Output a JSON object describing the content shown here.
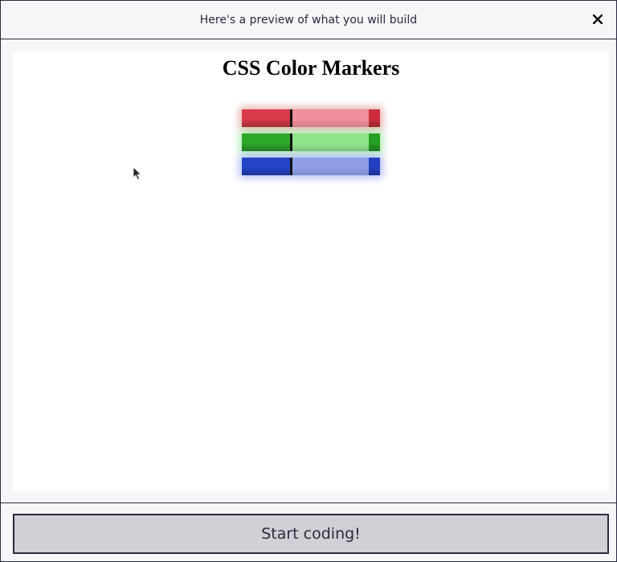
{
  "modal": {
    "title": "Here's a preview of what you will build",
    "close_icon": "close-icon"
  },
  "preview": {
    "heading": "CSS Color Markers",
    "markers": [
      {
        "name": "red",
        "cap_color": "#d93a4a",
        "body_color": "#f08f9e",
        "tip_color": "#cc2e3e",
        "glow": "#c0392b"
      },
      {
        "name": "green",
        "cap_color": "#2ea82a",
        "body_color": "#8fe38a",
        "tip_color": "#24a020",
        "glow": "#2ecc40"
      },
      {
        "name": "blue",
        "cap_color": "#2444c8",
        "body_color": "#8f9fe6",
        "tip_color": "#2440c0",
        "glow": "#3050e0"
      }
    ]
  },
  "footer": {
    "start_label": "Start coding!"
  },
  "colors": {
    "border": "#2a2a40",
    "button_bg": "#d0d0d5",
    "background": "#f5f6f7"
  },
  "cursor_icon": "mouse-pointer-icon"
}
